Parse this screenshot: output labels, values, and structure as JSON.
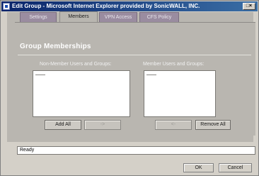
{
  "window": {
    "title": "Edit Group - Microsoft Internet Explorer provided by SonicWALL, INC."
  },
  "tabs": [
    {
      "label": "Settings",
      "active": false
    },
    {
      "label": "Members",
      "active": true
    },
    {
      "label": "VPN Access",
      "active": false
    },
    {
      "label": "CFS Policy",
      "active": false
    }
  ],
  "section": {
    "title": "Group Memberships"
  },
  "non_member_list": {
    "label": "Non-Member Users and Groups:",
    "items": []
  },
  "member_list": {
    "label": "Member Users and Groups:",
    "items": []
  },
  "buttons": {
    "add_all": "Add All",
    "add_left_arrow": "->",
    "remove_right_arrow": "<-",
    "remove_all": "Remove All",
    "ok": "OK",
    "cancel": "Cancel"
  },
  "status": {
    "text": "Ready"
  },
  "colors": {
    "titlebar": "#0a246a",
    "tab_inactive": "#9a8ca0",
    "panel": "#b9b6b0"
  },
  "icons": {
    "app": "ie-window-icon",
    "window_controls": "window-controls-icon"
  }
}
